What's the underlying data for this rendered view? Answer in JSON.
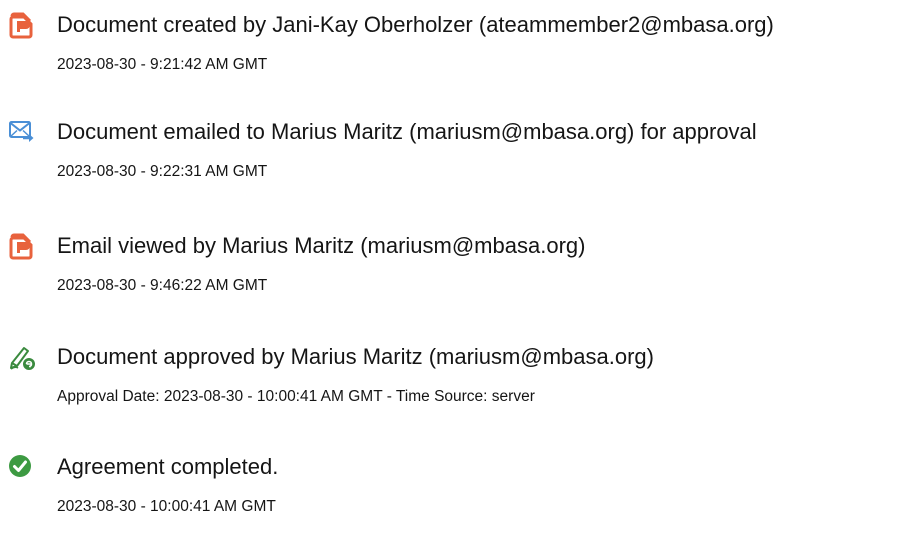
{
  "events": [
    {
      "icon": "document-created-icon",
      "title": "Document created by Jani-Kay Oberholzer (ateammember2@mbasa.org)",
      "detail": "2023-08-30 - 9:21:42 AM GMT"
    },
    {
      "icon": "email-sent-icon",
      "title": "Document emailed to Marius Maritz (mariusm@mbasa.org) for approval",
      "detail": "2023-08-30 - 9:22:31 AM GMT"
    },
    {
      "icon": "email-viewed-icon",
      "title": "Email viewed by Marius Maritz (mariusm@mbasa.org)",
      "detail": "2023-08-30 - 9:46:22 AM GMT"
    },
    {
      "icon": "approval-pen-icon",
      "title": "Document approved by Marius Maritz (mariusm@mbasa.org)",
      "detail": "Approval Date: 2023-08-30 - 10:00:41 AM GMT - Time Source: server"
    },
    {
      "icon": "agreement-completed-check-icon",
      "title": "Agreement completed.",
      "detail": "2023-08-30 - 10:00:41 AM GMT"
    }
  ],
  "colors": {
    "document_icon": "#e8623d",
    "email_icon": "#4a8fd6",
    "approval_icon": "#3a8a3e",
    "completed_icon": "#3d9a42",
    "text": "#151515"
  }
}
